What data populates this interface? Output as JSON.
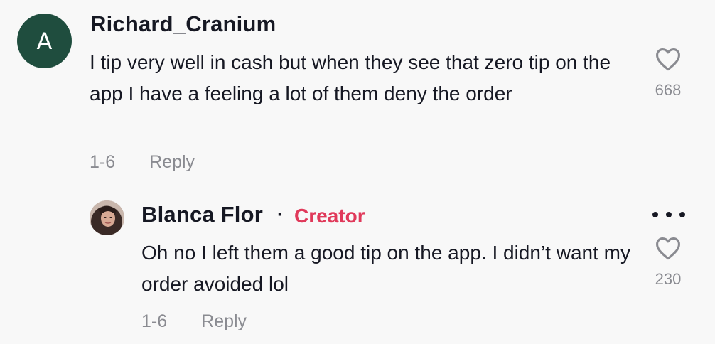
{
  "comments": [
    {
      "avatar_letter": "A",
      "username": "Richard_Cranium",
      "text": "I tip very well in cash but when they see that zero tip on the app I have a feeling a lot of them deny the order",
      "date": "1-6",
      "reply_label": "Reply",
      "likes": "668",
      "like_icon": "heart-outline-icon"
    }
  ],
  "replies": [
    {
      "username": "Blanca Flor",
      "separator": "·",
      "badge": "Creator",
      "text": "Oh no I left them a good tip on the app. I didn’t want my order avoided lol",
      "date": "1-6",
      "reply_label": "Reply",
      "likes": "230",
      "like_icon": "heart-outline-icon",
      "more_icon": "more-dots-icon"
    }
  ],
  "colors": {
    "background": "#f8f8f8",
    "avatar_bg": "#1f4d3e",
    "creator_badge": "#e0395a",
    "muted": "#8a8b91",
    "text": "#161823"
  }
}
